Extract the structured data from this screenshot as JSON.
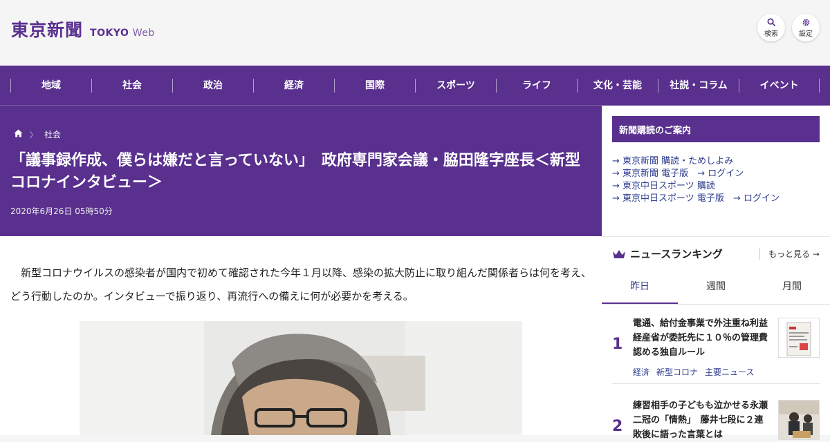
{
  "header": {
    "logo_jp": "東京新聞",
    "logo_en_bold": "TOKYO",
    "logo_en_light": "Web",
    "search_label": "検索",
    "settings_label": "設定"
  },
  "nav": {
    "items": [
      {
        "label": "地域"
      },
      {
        "label": "社会"
      },
      {
        "label": "政治"
      },
      {
        "label": "経済"
      },
      {
        "label": "国際"
      },
      {
        "label": "スポーツ"
      },
      {
        "label": "ライフ"
      },
      {
        "label": "文化・芸能"
      },
      {
        "label": "社説・コラム"
      },
      {
        "label": "イベント"
      }
    ]
  },
  "article": {
    "breadcrumb_icon": "home-icon",
    "breadcrumb_section": "社会",
    "title": "「議事録作成、僕らは嫌だと言っていない」　政府専門家会議・脇田隆字座長＜新型コロナインタビュー＞",
    "date": "2020年6月26日 05時50分",
    "lead": "新型コロナウイルスの感染者が国内で初めて確認された今年１月以降、感染の拡大防止に取り組んだ関係者らは何を考え、どう行動したのか。インタビューで振り返り、再流行への備えに何が必要かを考える。"
  },
  "sidebar": {
    "subscription_title": "新聞購読のご案内",
    "links": [
      {
        "text": "東京新聞 購読・ためしよみ"
      },
      {
        "text": "東京新聞 電子版",
        "extra": "ログイン"
      },
      {
        "text": "東京中日スポーツ 購読"
      },
      {
        "text": "東京中日スポーツ 電子版",
        "extra": "ログイン"
      }
    ],
    "ranking": {
      "icon": "crown-icon",
      "title": "ニュースランキング",
      "more": "もっと見る",
      "tabs": [
        "昨日",
        "週間",
        "月間"
      ],
      "items": [
        {
          "rank": "1",
          "title": "電通、給付金事業で外注重ね利益　経産省が委託先に１０％の管理費認める独自ルール",
          "tags": [
            "経済",
            "新型コロナ",
            "主要ニュース"
          ]
        },
        {
          "rank": "2",
          "title": "練習相手の子どもも泣かせる永瀬二冠の「情熱」　藤井七段に２連敗後に語った言葉とは",
          "tags": []
        }
      ]
    }
  },
  "colors": {
    "brand_purple": "#59308e",
    "link_blue": "#2e3d8f"
  }
}
